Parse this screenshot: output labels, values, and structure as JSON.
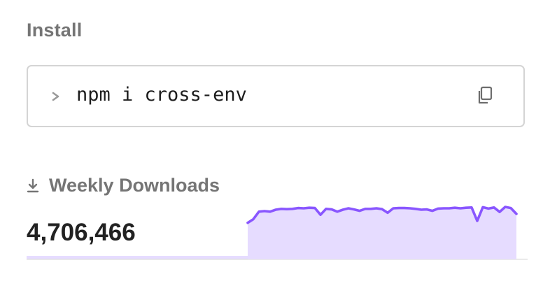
{
  "install": {
    "heading": "Install",
    "command": "npm i cross-env",
    "prompt_icon": "chevron-right-icon",
    "copy_icon": "copy-icon"
  },
  "weekly_downloads": {
    "label": "Weekly Downloads",
    "icon": "download-icon",
    "count": "4,706,466",
    "sparkline_color": "#8956ff",
    "sparkline_fill": "#e6dcff",
    "trend": [
      0.43,
      0.56,
      0.83,
      0.85,
      0.83,
      0.9,
      0.93,
      0.92,
      0.93,
      0.96,
      0.95,
      0.97,
      0.96,
      0.72,
      0.93,
      0.91,
      0.83,
      0.9,
      0.95,
      0.91,
      0.86,
      0.93,
      0.93,
      0.95,
      0.92,
      0.79,
      0.95,
      0.96,
      0.96,
      0.95,
      0.93,
      0.9,
      0.91,
      0.86,
      0.94,
      0.95,
      0.95,
      0.97,
      0.95,
      0.97,
      0.98,
      0.5,
      0.99,
      0.94,
      0.98,
      0.82,
      1.0,
      0.96,
      0.75
    ]
  }
}
